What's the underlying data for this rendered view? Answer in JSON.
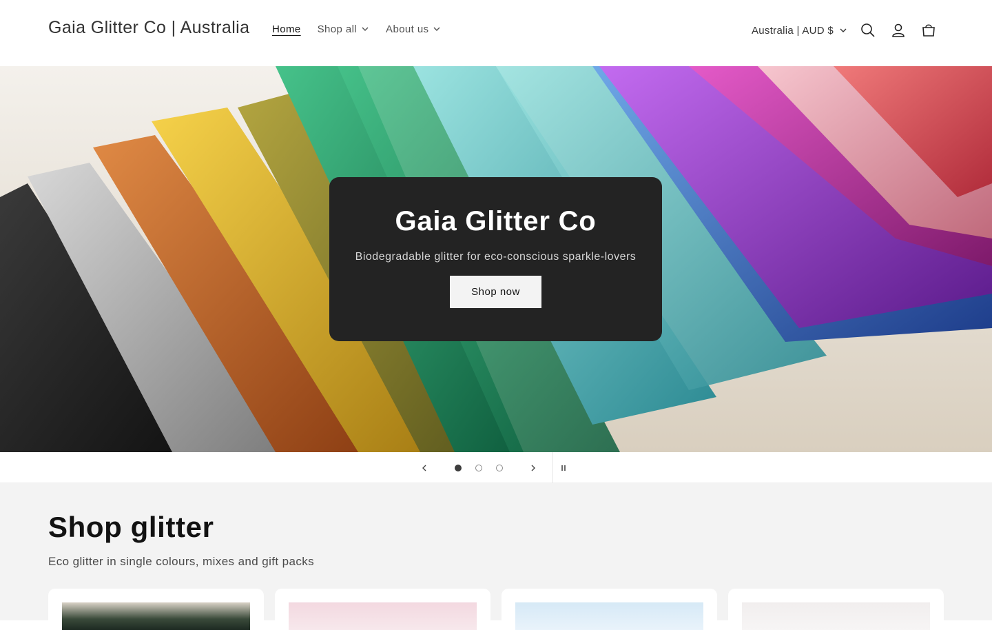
{
  "header": {
    "brand": "Gaia Glitter Co | Australia",
    "nav": [
      {
        "label": "Home",
        "active": true,
        "dropdown": false
      },
      {
        "label": "Shop all",
        "active": false,
        "dropdown": true
      },
      {
        "label": "About us",
        "active": false,
        "dropdown": true
      }
    ],
    "country_selector": "Australia | AUD $",
    "icons": [
      "search-icon",
      "account-icon",
      "cart-icon"
    ]
  },
  "hero": {
    "title": "Gaia Glitter Co",
    "subtitle": "Biodegradable glitter for eco-conscious sparkle-lovers",
    "button_label": "Shop now"
  },
  "slider": {
    "slide_count": 3,
    "active_slide": 1,
    "icons": [
      "chevron-left-icon",
      "chevron-right-icon",
      "pause-icon"
    ]
  },
  "shop_section": {
    "title": "Shop glitter",
    "subtitle": "Eco glitter in single colours, mixes and gift packs",
    "card_count": 4
  },
  "colors": {
    "hero_box": "#232323",
    "section_bg": "#f3f3f3",
    "text_primary": "#121212"
  }
}
